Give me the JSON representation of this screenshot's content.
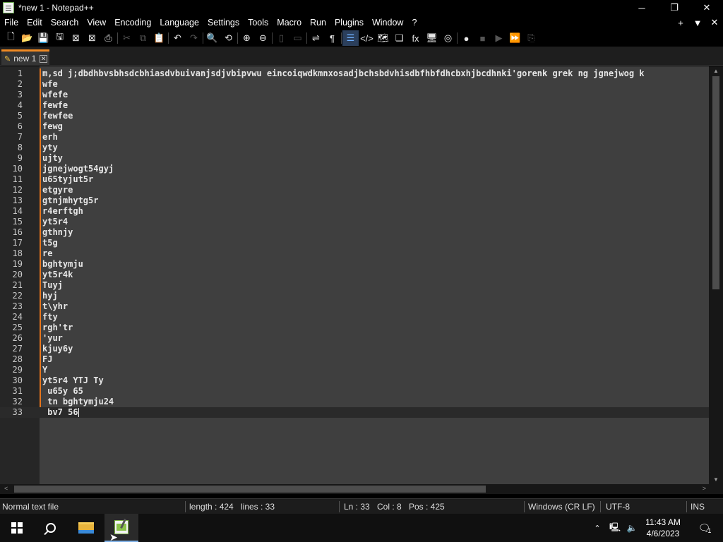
{
  "window": {
    "title": "*new 1 - Notepad++",
    "minimize": "─",
    "restore": "❐",
    "close": "✕"
  },
  "menu": {
    "items": [
      "File",
      "Edit",
      "Search",
      "View",
      "Encoding",
      "Language",
      "Settings",
      "Tools",
      "Macro",
      "Run",
      "Plugins",
      "Window",
      "?"
    ],
    "right": [
      "+",
      "▼",
      "✕"
    ]
  },
  "toolbar": {
    "buttons": [
      {
        "name": "new-file-icon",
        "glyph": "🗋",
        "enabled": true
      },
      {
        "name": "open-file-icon",
        "glyph": "📂",
        "enabled": true
      },
      {
        "name": "save-icon",
        "glyph": "💾",
        "enabled": true
      },
      {
        "name": "save-all-icon",
        "glyph": "🖫",
        "enabled": true
      },
      {
        "name": "close-icon",
        "glyph": "⊠",
        "enabled": true
      },
      {
        "name": "close-all-icon",
        "glyph": "⊠",
        "enabled": true
      },
      {
        "name": "print-icon",
        "glyph": "⎙",
        "enabled": true
      },
      {
        "name": "cut-icon",
        "glyph": "✂",
        "enabled": false
      },
      {
        "name": "copy-icon",
        "glyph": "⧉",
        "enabled": false
      },
      {
        "name": "paste-icon",
        "glyph": "📋",
        "enabled": false
      },
      {
        "name": "undo-icon",
        "glyph": "↶",
        "enabled": true
      },
      {
        "name": "redo-icon",
        "glyph": "↷",
        "enabled": false
      },
      {
        "name": "find-icon",
        "glyph": "🔍",
        "enabled": true
      },
      {
        "name": "replace-icon",
        "glyph": "⟲",
        "enabled": true
      },
      {
        "name": "zoom-in-icon",
        "glyph": "⊕",
        "enabled": true
      },
      {
        "name": "zoom-out-icon",
        "glyph": "⊖",
        "enabled": true
      },
      {
        "name": "sync-vertical-icon",
        "glyph": "▯",
        "enabled": false
      },
      {
        "name": "sync-horizontal-icon",
        "glyph": "▭",
        "enabled": false
      },
      {
        "name": "word-wrap-icon",
        "glyph": "⇌",
        "enabled": true
      },
      {
        "name": "show-all-chars-icon",
        "glyph": "¶",
        "enabled": true
      },
      {
        "name": "indent-guide-icon",
        "glyph": "☰",
        "enabled": true,
        "active": true
      },
      {
        "name": "xml-tag-icon",
        "glyph": "</>",
        "enabled": true
      },
      {
        "name": "document-map-icon",
        "glyph": "🗺",
        "enabled": true
      },
      {
        "name": "document-list-icon",
        "glyph": "❏",
        "enabled": true
      },
      {
        "name": "function-list-icon",
        "glyph": "fx",
        "enabled": true
      },
      {
        "name": "folder-workspace-icon",
        "glyph": "🖥",
        "enabled": true
      },
      {
        "name": "monitoring-icon",
        "glyph": "◎",
        "enabled": true
      },
      {
        "name": "record-macro-icon",
        "glyph": "●",
        "enabled": true
      },
      {
        "name": "stop-record-icon",
        "glyph": "■",
        "enabled": false
      },
      {
        "name": "playback-macro-icon",
        "glyph": "▶",
        "enabled": false
      },
      {
        "name": "run-macro-multiple-icon",
        "glyph": "⏩",
        "enabled": true
      },
      {
        "name": "save-macro-icon",
        "glyph": "⎘",
        "enabled": false
      }
    ]
  },
  "tab": {
    "label": "new 1",
    "close": "✕"
  },
  "editor": {
    "current_line": 33,
    "lines": [
      "m,sd j;dbdhbvsbhsdcbhiasdvbuivanjsdjvbipvwu eincoiqwdkmnxosadjbchsbdvhisdbfhbfdhcbxhjbcdhnki'gorenk grek ng jgnejwog k",
      "wfe",
      "wfefe",
      "fewfe",
      "fewfee",
      "fewg",
      "erh",
      "yty",
      "ujty",
      "jgnejwogt54gyj",
      "u65tyjut5r",
      "etgyre",
      "gtnjmhytg5r",
      "r4erftgh",
      "yt5r4",
      "gthnjy",
      "t5g",
      "re",
      "bghtymju",
      "yt5r4k",
      "Tuyj",
      "hyj",
      "t\\yhr",
      "fty",
      "rgh'tr",
      "'yur",
      "kjuy6y",
      "FJ",
      "Y",
      "yt5r4 YTJ Ty",
      " u65y 65",
      " tn bghtymju24",
      " bv7 56"
    ]
  },
  "scrollbars": {
    "left_arrow": "<",
    "right_arrow": ">",
    "up_arrow": "▲",
    "down_arrow": "▼"
  },
  "status": {
    "file_type": "Normal text file",
    "length": "length : 424",
    "lines": "lines : 33",
    "ln": "Ln : 33",
    "col": "Col : 8",
    "pos": "Pos : 425",
    "eol": "Windows (CR LF)",
    "encoding": "UTF-8",
    "mode": "INS"
  },
  "taskbar": {
    "time": "11:43 AM",
    "date": "4/6/2023",
    "notifications": "1"
  }
}
